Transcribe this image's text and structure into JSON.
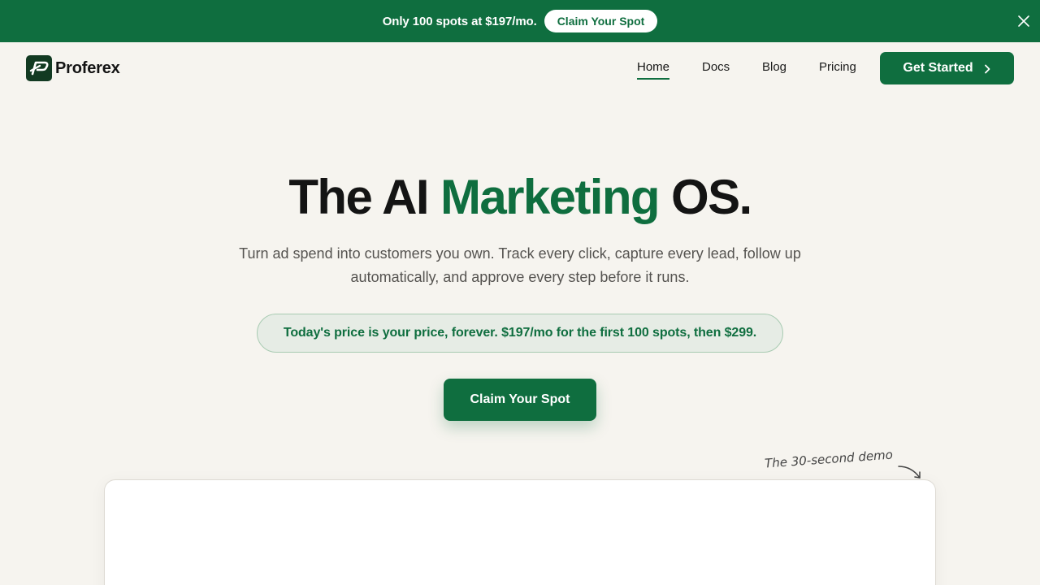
{
  "announcement": {
    "text": "Only 100 spots at $197/mo.",
    "button_label": "Claim Your Spot",
    "close_icon": "close-icon"
  },
  "header": {
    "brand": "Proferex",
    "logo_icon": "brand-logo-icon",
    "nav": [
      {
        "label": "Home",
        "active": true
      },
      {
        "label": "Docs",
        "active": false
      },
      {
        "label": "Blog",
        "active": false
      },
      {
        "label": "Pricing",
        "active": false
      }
    ],
    "cta_label": "Get Started",
    "cta_icon": "chevron-right-icon"
  },
  "hero": {
    "title_prefix": "The AI",
    "title_accent": "Marketing",
    "title_suffix": "OS.",
    "subtitle": "Turn ad spend into customers you own. Track every click, capture every lead, follow up automatically, and approve every step before it runs.",
    "price_note": "Today's price is your price, forever. $197/mo for the first 100 spots, then $299.",
    "button_label": "Claim Your Spot"
  },
  "demo": {
    "note": "The 30-second demo"
  },
  "colors": {
    "brand_green": "#0f6e3f",
    "background": "#f6f4ef",
    "logo_dark": "#123a22"
  }
}
